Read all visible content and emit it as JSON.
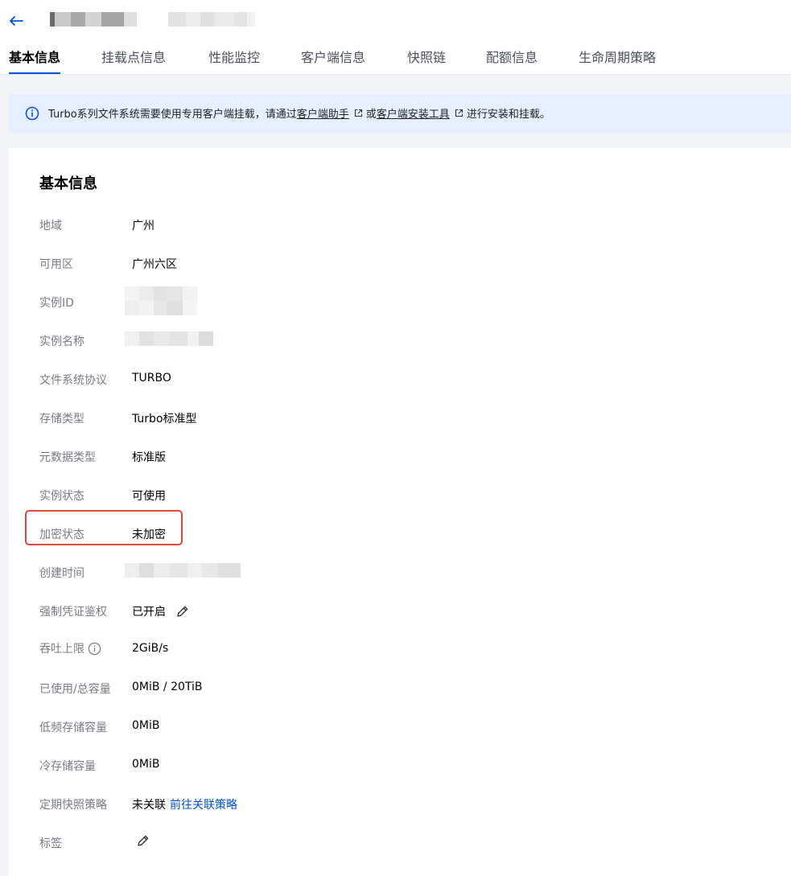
{
  "tabs": [
    {
      "label": "基本信息",
      "active": true
    },
    {
      "label": "挂载点信息",
      "active": false
    },
    {
      "label": "性能监控",
      "active": false
    },
    {
      "label": "客户端信息",
      "active": false
    },
    {
      "label": "快照链",
      "active": false
    },
    {
      "label": "配额信息",
      "active": false
    },
    {
      "label": "生命周期策略",
      "active": false
    }
  ],
  "notice": {
    "prefix": "Turbo系列文件系统需要使用专用客户端挂载，请通过",
    "link1": "客户端助手",
    "middle": "或",
    "link2": "客户端安装工具",
    "suffix": "进行安装和挂载。"
  },
  "card": {
    "title": "基本信息",
    "rows": {
      "region": {
        "label": "地域",
        "value": "广州"
      },
      "zone": {
        "label": "可用区",
        "value": "广州六区"
      },
      "instance_id": {
        "label": "实例ID"
      },
      "instance_name": {
        "label": "实例名称"
      },
      "protocol": {
        "label": "文件系统协议",
        "value": "TURBO"
      },
      "storage_type": {
        "label": "存储类型",
        "value": "Turbo标准型"
      },
      "metadata_type": {
        "label": "元数据类型",
        "value": "标准版"
      },
      "status": {
        "label": "实例状态",
        "value": "可使用"
      },
      "encryption": {
        "label": "加密状态",
        "value": "未加密"
      },
      "created": {
        "label": "创建时间"
      },
      "auth": {
        "label": "强制凭证鉴权",
        "value": "已开启"
      },
      "throughput": {
        "label": "吞吐上限",
        "value": "2GiB/s"
      },
      "capacity": {
        "label": "已使用/总容量",
        "value": "0MiB / 20TiB"
      },
      "low_freq": {
        "label": "低频存储容量",
        "value": "0MiB"
      },
      "cold": {
        "label": "冷存储容量",
        "value": "0MiB"
      },
      "snapshot_policy": {
        "label": "定期快照策略",
        "value": "未关联",
        "link": "前往关联策略"
      },
      "tags": {
        "label": "标签"
      }
    }
  },
  "colors": {
    "accent": "#0052d9",
    "highlight": "#e1483c",
    "notice_bg": "#e6efff"
  },
  "icons": {
    "back": "arrow-left-icon",
    "info": "info-circle-icon",
    "external": "external-link-icon",
    "edit": "pencil-icon",
    "help": "info-circle-icon"
  }
}
